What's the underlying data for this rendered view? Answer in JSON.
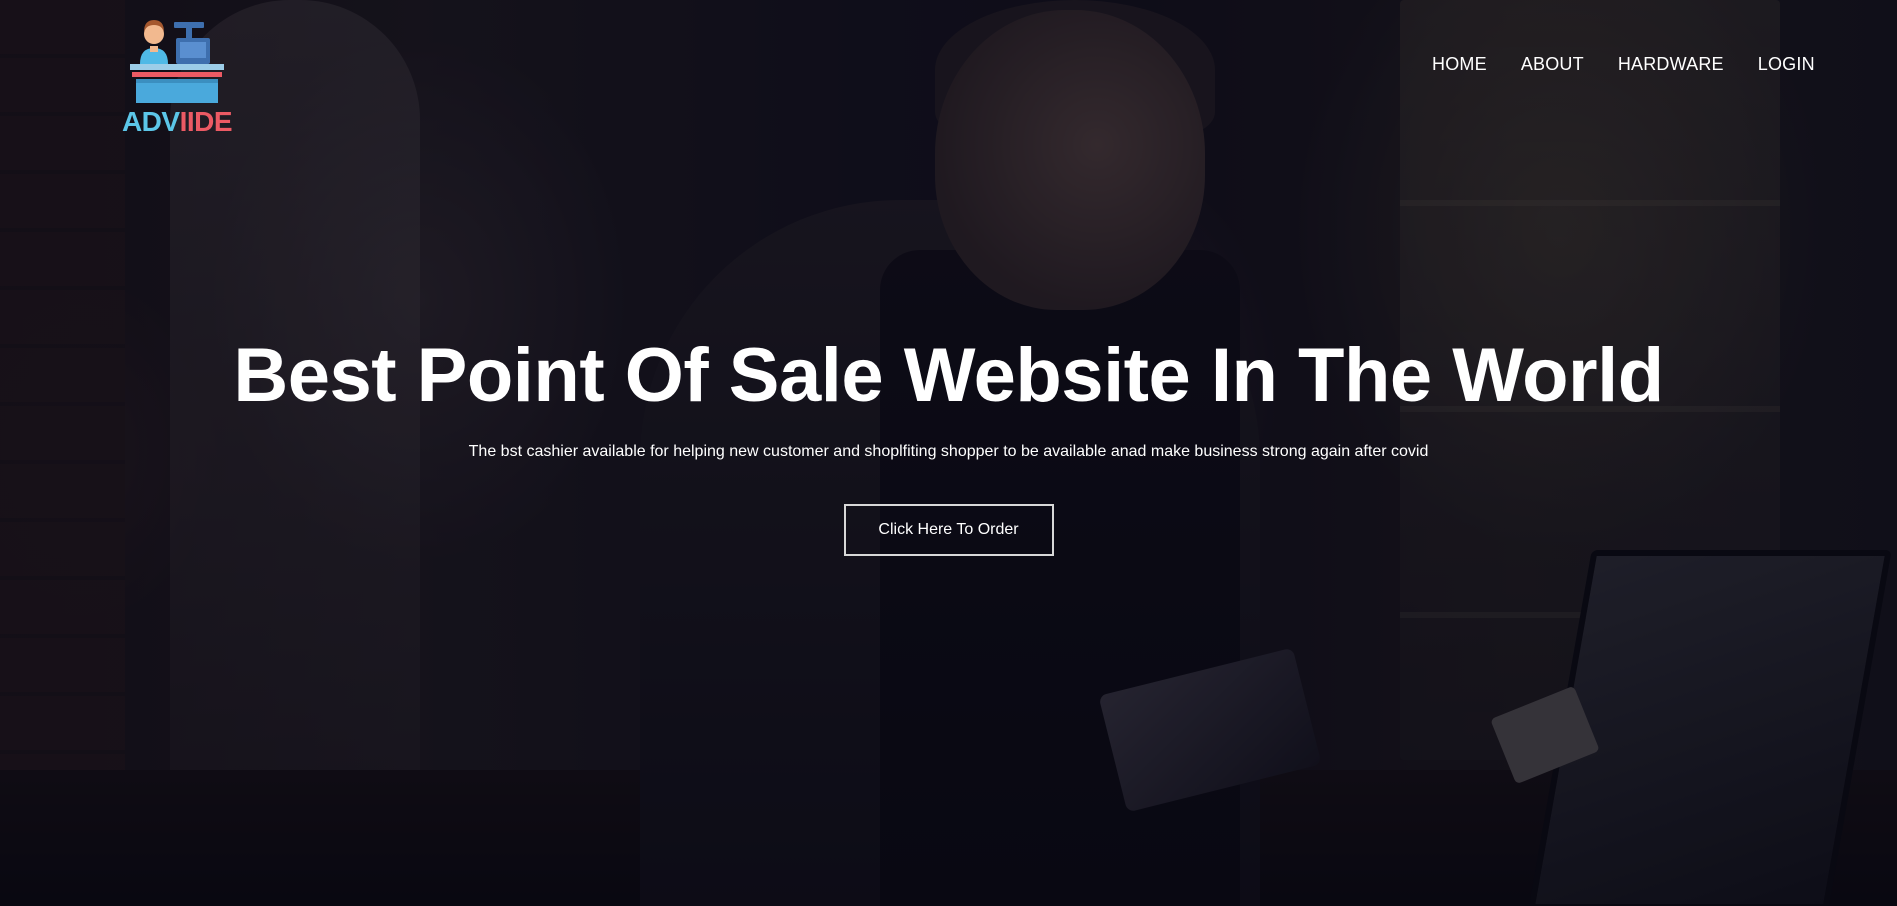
{
  "header": {
    "logo": {
      "text_part_a": "ADV",
      "text_part_b": "IIDE",
      "icon": "cashier-counter-icon"
    },
    "nav": {
      "items": [
        {
          "label": "HOME"
        },
        {
          "label": "ABOUT"
        },
        {
          "label": "HARDWARE"
        },
        {
          "label": "LOGIN"
        }
      ]
    }
  },
  "hero": {
    "title": "Best Point Of Sale Website In The World",
    "subtitle": "The bst cashier available for helping new customer and shoplfiting shopper to be available anad make business strong again after covid",
    "cta_label": "Click Here To Order"
  },
  "colors": {
    "logo_blue": "#5cc6e8",
    "logo_red": "#ec5a64",
    "text": "#ffffff",
    "overlay": "#080816"
  }
}
